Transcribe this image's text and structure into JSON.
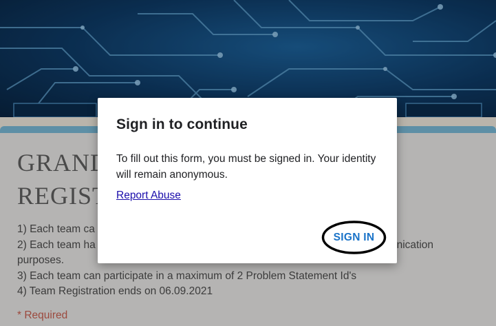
{
  "banner": {
    "image": "circuit-board-banner"
  },
  "form": {
    "title_line1": "GRAND",
    "title_line2": "REGIST",
    "rules": [
      "1) Each team ca",
      "2) Each team ha",
      "unication",
      "purposes.",
      "3) Each team can participate in a maximum of 2 Problem Statement Id's",
      "4) Team Registration ends on 06.09.2021"
    ],
    "required": "* Required"
  },
  "dialog": {
    "title": "Sign in to continue",
    "body": "To fill out this form, you must be signed in. Your identity will remain anonymous.",
    "report_link": "Report Abuse",
    "signin_label": "SIGN IN"
  },
  "colors": {
    "accent": "#1a73c8",
    "link": "#1a0dab",
    "required": "#9c4a3e",
    "strip": "#5d8fa6"
  }
}
